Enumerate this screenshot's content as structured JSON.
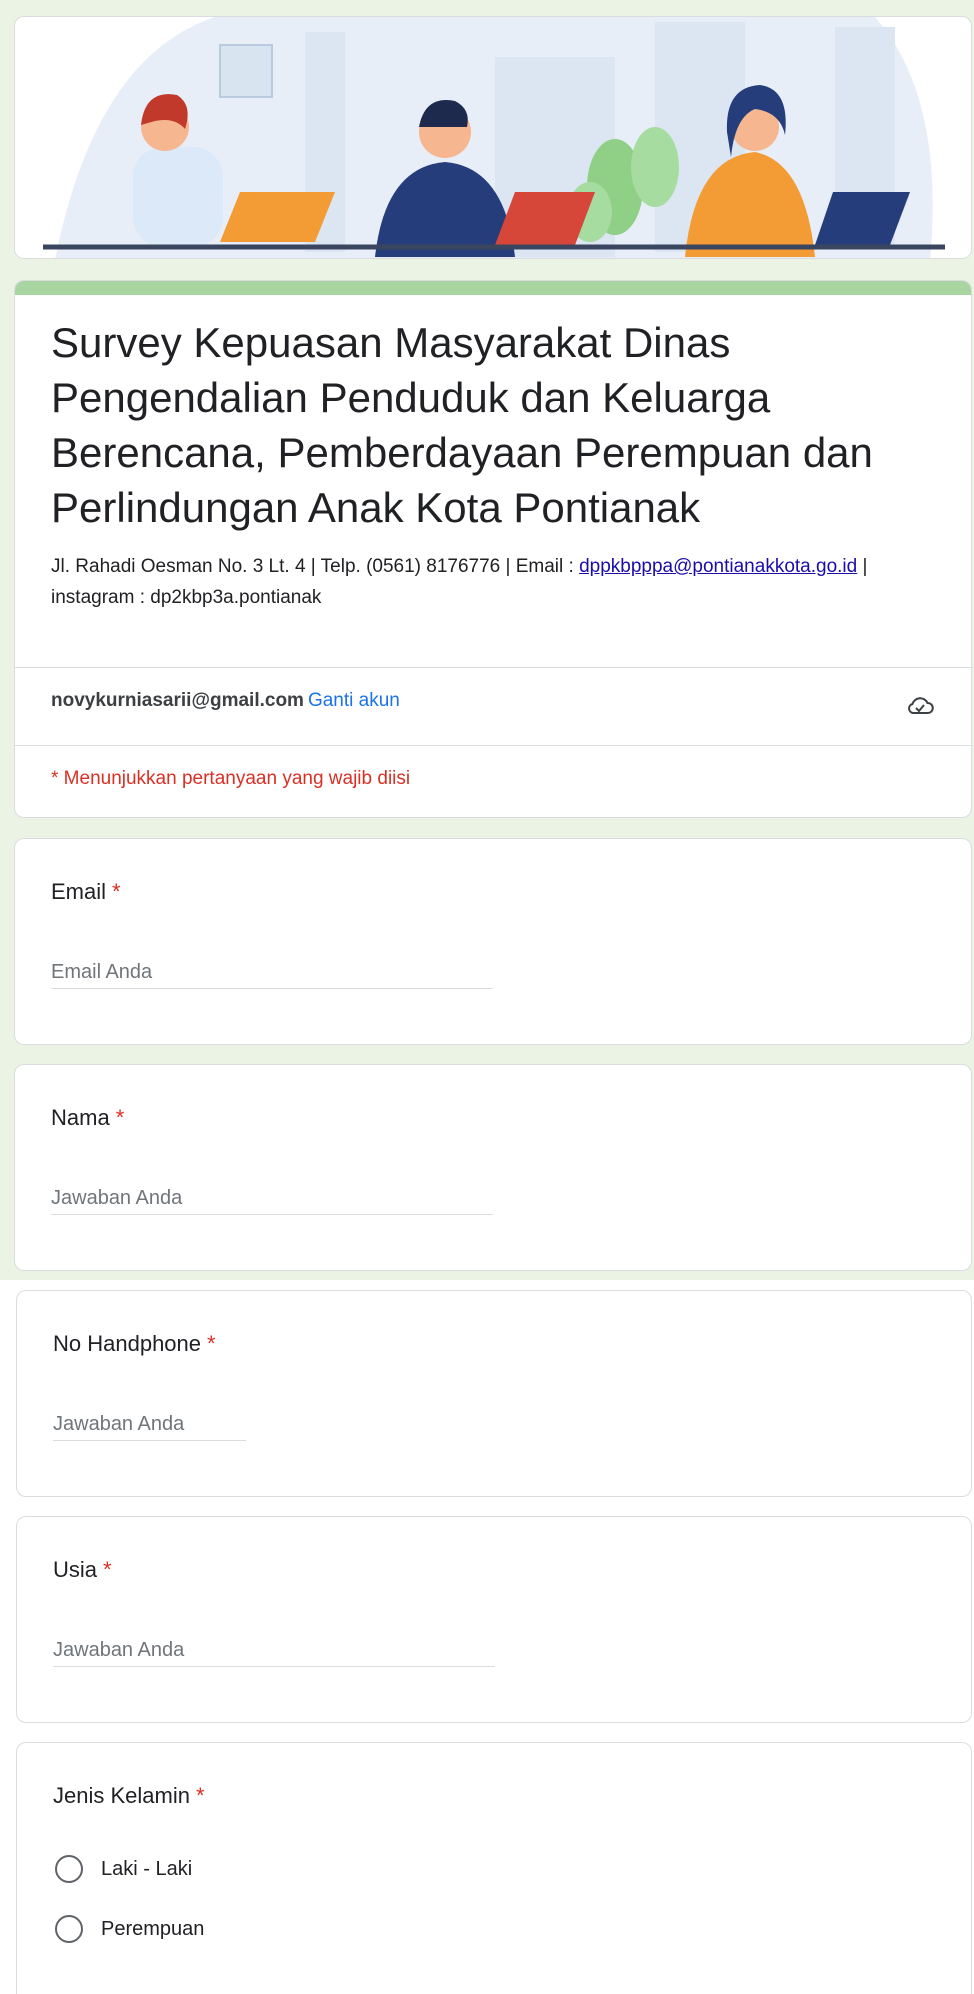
{
  "form": {
    "title": "Survey Kepuasan Masyarakat Dinas Pengendalian Penduduk dan Keluarga Berencana, Pemberdayaan Perempuan dan Perlindungan Anak Kota Pontianak",
    "description_prefix": "Jl. Rahadi Oesman No. 3 Lt. 4  | Telp. (0561) 8176776  | Email : ",
    "description_email": "dppkbpppa@pontianakkota.go.id",
    "description_suffix": " | instagram : dp2kbp3a.pontianak",
    "account_email": "novykurniasarii@gmail.com",
    "switch_account": "Ganti akun",
    "required_note": "* Menunjukkan pertanyaan yang wajib diisi"
  },
  "questions": [
    {
      "label": "Email",
      "required_mark": "*",
      "placeholder": "Email Anda"
    },
    {
      "label": "Nama",
      "required_mark": "*",
      "placeholder": "Jawaban Anda"
    },
    {
      "label": "No Handphone",
      "required_mark": "*",
      "placeholder": "Jawaban Anda"
    },
    {
      "label": "Usia",
      "required_mark": "*",
      "placeholder": "Jawaban Anda"
    },
    {
      "label": "Jenis Kelamin",
      "required_mark": "*",
      "options": [
        "Laki - Laki",
        "Perempuan"
      ]
    }
  ],
  "icons": {
    "cloud": "cloud-check-icon",
    "radio": "radio-unchecked-icon"
  },
  "colors": {
    "accent": "#a8d5a0",
    "required": "#d93025",
    "link": "#1a73e8",
    "background": "#eaf3e4"
  }
}
